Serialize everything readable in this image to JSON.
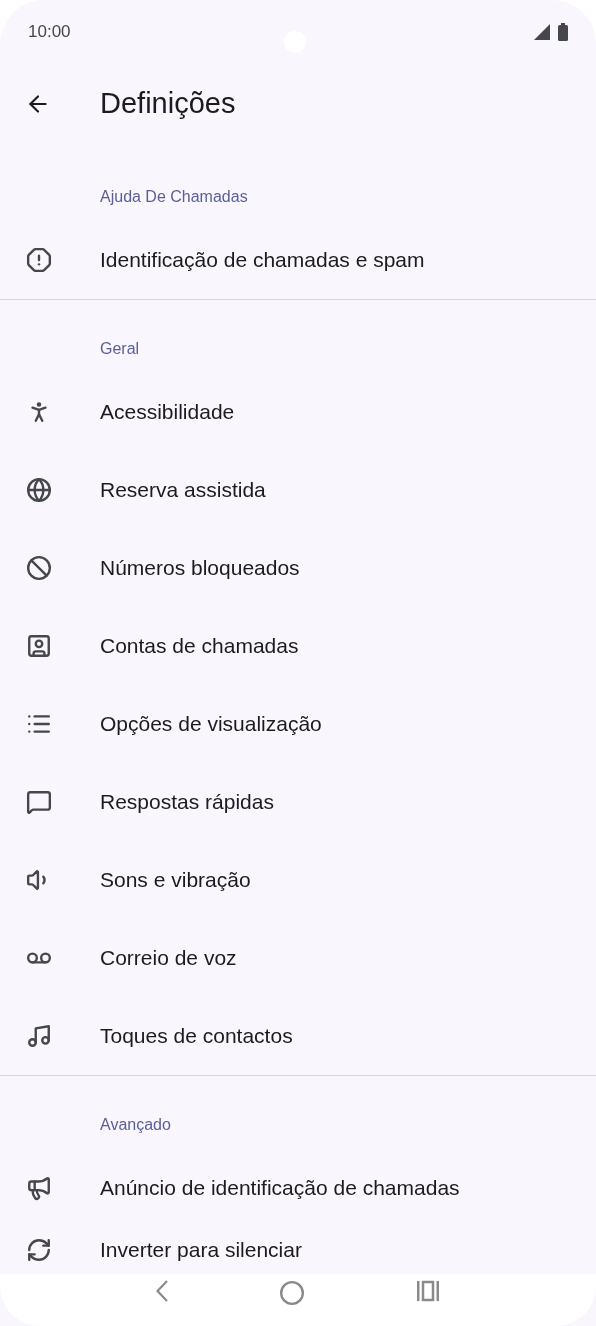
{
  "status_bar": {
    "time": "10:00"
  },
  "toolbar": {
    "title": "Definições"
  },
  "sections": [
    {
      "header": "Ajuda De Chamadas",
      "items": [
        {
          "label": "Identificação de chamadas e spam"
        }
      ]
    },
    {
      "header": "Geral",
      "items": [
        {
          "label": "Acessibilidade"
        },
        {
          "label": "Reserva assistida"
        },
        {
          "label": "Números bloqueados"
        },
        {
          "label": "Contas de chamadas"
        },
        {
          "label": "Opções de visualização"
        },
        {
          "label": "Respostas rápidas"
        },
        {
          "label": "Sons e vibração"
        },
        {
          "label": "Correio de voz"
        },
        {
          "label": "Toques de contactos"
        }
      ]
    },
    {
      "header": "Avançado",
      "items": [
        {
          "label": "Anúncio de identificação de chamadas"
        },
        {
          "label": "Inverter para silenciar"
        }
      ]
    }
  ]
}
